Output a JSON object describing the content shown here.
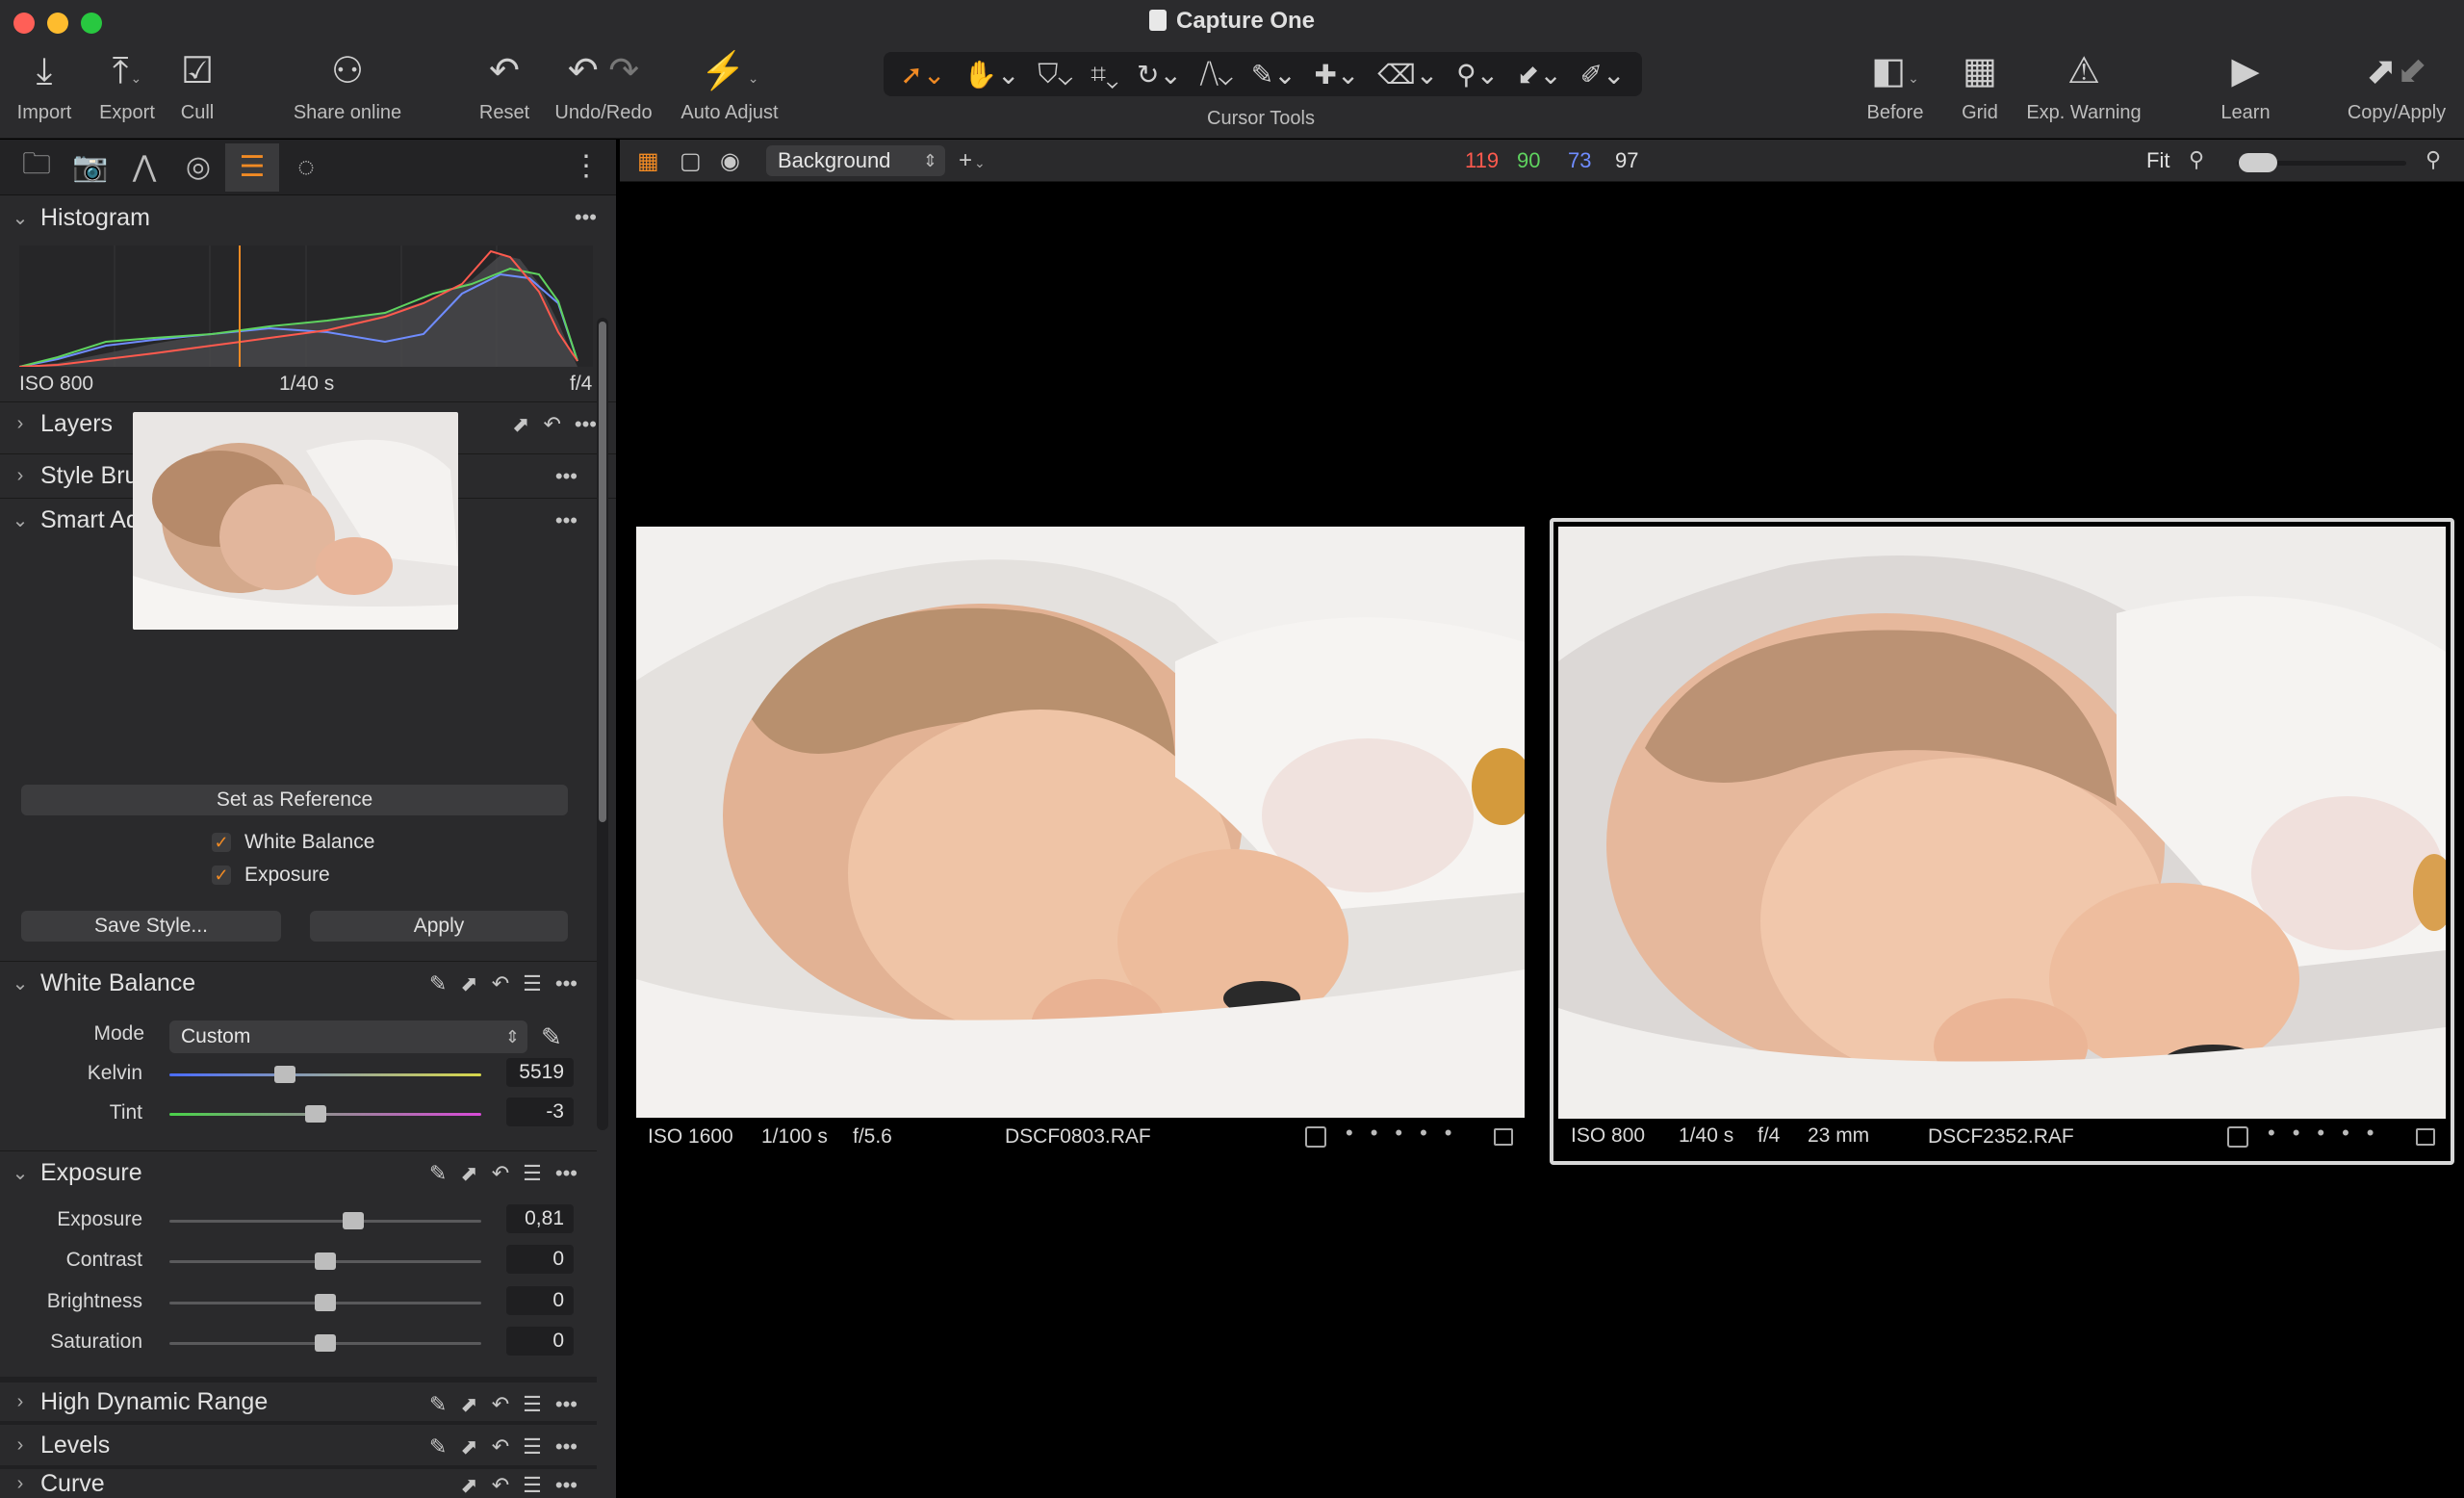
{
  "window": {
    "title": "Capture One",
    "traffic_colors": [
      "#ff5f57",
      "#febc2e",
      "#28c840"
    ]
  },
  "toolbar": {
    "import_label": "Import",
    "export_label": "Export",
    "cull_label": "Cull",
    "share_label": "Share online",
    "reset_label": "Reset",
    "undo_redo_label": "Undo/Redo",
    "auto_adjust_label": "Auto Adjust",
    "cursor_tools_label": "Cursor Tools",
    "before_label": "Before",
    "grid_label": "Grid",
    "exp_warning_label": "Exp. Warning",
    "learn_label": "Learn",
    "copy_apply_label": "Copy/Apply"
  },
  "viewer_bar": {
    "background_select": "Background",
    "rgb": {
      "r": "119",
      "g": "90",
      "b": "73",
      "l": "97"
    },
    "fit_label": "Fit"
  },
  "histogram": {
    "title": "Histogram",
    "iso": "ISO 800",
    "shutter": "1/40 s",
    "aperture": "f/4"
  },
  "sections": {
    "layers": "Layers",
    "style_brushes": "Style Brushes",
    "smart_adjustments": "Smart Adjustments",
    "white_balance": "White Balance",
    "exposure": "Exposure",
    "hdr": "High Dynamic Range",
    "levels": "Levels",
    "curve": "Curve"
  },
  "smart": {
    "set_reference": "Set as Reference",
    "wb_check": "White Balance",
    "exposure_check": "Exposure",
    "save_style": "Save Style...",
    "apply": "Apply"
  },
  "white_balance": {
    "mode_label": "Mode",
    "mode_value": "Custom",
    "kelvin_label": "Kelvin",
    "kelvin_value": "5519",
    "kelvin_level": 0.37,
    "tint_label": "Tint",
    "tint_value": "-3",
    "tint_level": 0.47
  },
  "exposure": {
    "rows": [
      {
        "label": "Exposure",
        "value": "0,81",
        "level": 0.59
      },
      {
        "label": "Contrast",
        "value": "0",
        "level": 0.5
      },
      {
        "label": "Brightness",
        "value": "0",
        "level": 0.5
      },
      {
        "label": "Saturation",
        "value": "0",
        "level": 0.5
      }
    ]
  },
  "photos": [
    {
      "iso": "ISO 1600",
      "shutter": "1/100 s",
      "aperture": "f/5.6",
      "focal": "",
      "filename": "DSCF0803.RAF"
    },
    {
      "iso": "ISO 800",
      "shutter": "1/40 s",
      "aperture": "f/4",
      "focal": "23 mm",
      "filename": "DSCF2352.RAF"
    }
  ],
  "colors": {
    "accent": "#f08a24",
    "r": "#ff5a4e",
    "g": "#5fd35f",
    "b": "#6f8cff"
  }
}
